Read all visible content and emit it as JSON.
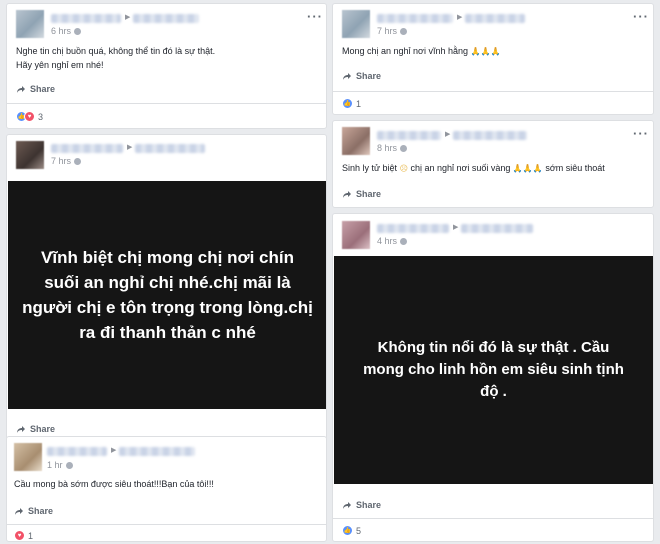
{
  "posts": [
    {
      "time": "6 hrs",
      "text": [
        "Nghe tin chị buồn quá, không thể tin đó là sự thật.",
        "Hãy yên nghỉ em nhé!"
      ],
      "share_label": "Share",
      "reaction_count": "3"
    },
    {
      "time": "7 hrs",
      "text": "Mong chị an nghỉ nơi vĩnh hằng",
      "share_label": "Share",
      "reaction_count": "1"
    },
    {
      "time": "7 hrs",
      "image_text": "Vĩnh biệt chị mong chị nơi chín suối an nghỉ chị nhé.chị mãi là người chị e tôn trọng trong lòng.chị ra đi thanh thản c nhé",
      "share_label": "Share"
    },
    {
      "time": "8 hrs",
      "text_a": "Sinh ly tử biệt",
      "text_b": "chị an nghỉ nơi suối vàng",
      "text_c": "sớm siêu thoát",
      "share_label": "Share"
    },
    {
      "time": "4 hrs",
      "image_text": "Không tin nổi đó là sự thật . Cầu mong cho linh hồn em siêu sinh tịnh độ .",
      "share_label": "Share",
      "reaction_count": "5"
    },
    {
      "time": "1 hr",
      "text": "Cầu mong bà sớm được siêu thoát!!!Bạn của tôi!!!",
      "share_label": "Share",
      "reaction_count": "1"
    }
  ],
  "icons": {
    "more": "more-options-icon",
    "share": "share-arrow-icon",
    "like": "like-reaction-icon",
    "love": "love-reaction-icon",
    "privacy": "globe-icon",
    "emoji_pray": "folded-hands-emoji",
    "emoji_sad": "sad-face-emoji"
  },
  "colors": {
    "background": "#e9ebee",
    "like": "#5890ff",
    "love": "#f25268",
    "image_bg": "#151515"
  }
}
